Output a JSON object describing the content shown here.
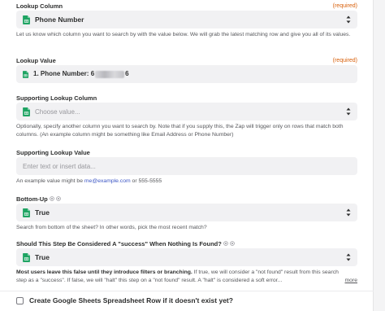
{
  "colors": {
    "accent": "#d8600b",
    "link": "#3b55c4",
    "field_bg": "#f1f1f3",
    "sheets_green": "#1fa463"
  },
  "icons": {
    "sheets": "google-sheets-icon",
    "chevron": "chevron-up-down-icon",
    "info": "info-icon"
  },
  "lookup_column": {
    "label": "Lookup Column",
    "required": "(required)",
    "value": "Phone Number",
    "help": "Let us know which column you want to search by with the value below. We will grab the latest matching row and give you all of its values."
  },
  "lookup_value": {
    "label": "Lookup Value",
    "required": "(required)",
    "value_prefix": "1. Phone Number:",
    "value_start": "6",
    "value_end": "6"
  },
  "supporting_column": {
    "label": "Supporting Lookup Column",
    "placeholder": "Choose value...",
    "help": "Optionally, specify another column you want to search by. Note that if you supply this, the Zap will trigger only on rows that match both columns. (An example column might be something like Email Address or Phone Number)"
  },
  "supporting_value": {
    "label": "Supporting Lookup Value",
    "placeholder": "Enter text or insert data...",
    "help_prefix": "An example value might be ",
    "help_email": "me@example.com",
    "help_suffix": " or 555-5555"
  },
  "bottom_up": {
    "label": "Bottom-Up",
    "value": "True",
    "help": "Search from bottom of the sheet? In other words, pick the most recent match?"
  },
  "success_nothing": {
    "label": "Should This Step Be Considered A \"success\" When Nothing Is Found?",
    "value": "True",
    "help_bold": "Most users leave this false until they introduce filters or branching.",
    "help_rest": " If true, we will consider a \"not found\" result from this search step as a \"success\". If false, we will \"halt\" this step on a \"not found\" result. A \"halt\" is considered a soft error...",
    "more": "more"
  },
  "create_row": {
    "label": "Create Google Sheets Spreadsheet Row if it doesn't exist yet?",
    "checked": false
  }
}
